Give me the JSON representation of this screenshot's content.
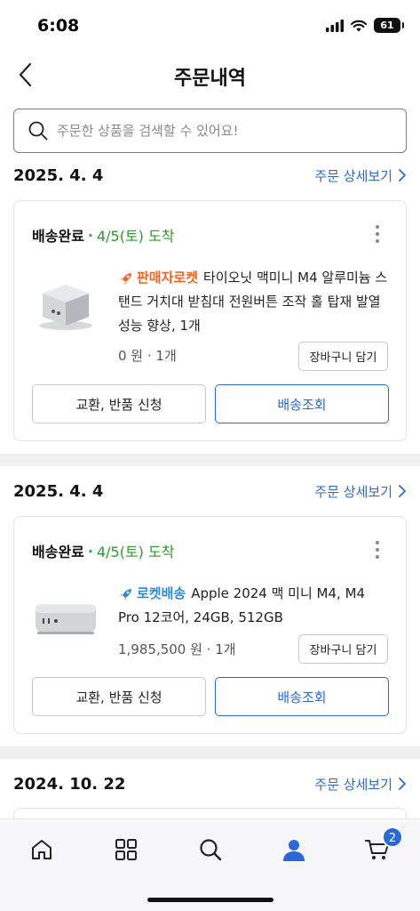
{
  "status_bar": {
    "time": "6:08",
    "battery": "61"
  },
  "header": {
    "title": "주문내역"
  },
  "search": {
    "placeholder": "주문한 상품을 검색할 수 있어요!"
  },
  "orders": [
    {
      "date": "2025. 4. 4",
      "detail_link": "주문 상세보기",
      "status": "배송완료",
      "arrival": "4/5(토) 도착",
      "badge": "판매자로켓",
      "product_name": "타이오닛 맥미니 M4 알루미늄 스탠드 거치대 받침대 전원버튼 조작 홀 탑재 발열 성능 향상, 1개",
      "price_qty": "0 원 · 1개",
      "cart_button": "장바구니 담기",
      "exchange_button": "교환, 반품 신청",
      "tracking_button": "배송조회"
    },
    {
      "date": "2025. 4. 4",
      "detail_link": "주문 상세보기",
      "status": "배송완료",
      "arrival": "4/5(토) 도착",
      "badge": "로켓배송",
      "product_name": "Apple 2024 맥 미니 M4, M4 Pro 12코어, 24GB, 512GB",
      "price_qty": "1,985,500 원 · 1개",
      "cart_button": "장바구니 담기",
      "exchange_button": "교환, 반품 신청",
      "tracking_button": "배송조회"
    },
    {
      "date": "2024. 10. 22",
      "detail_link": "주문 상세보기"
    }
  ],
  "bottom_nav": {
    "items": [
      "home-icon",
      "categories-icon",
      "search-icon",
      "my-account-icon",
      "cart-icon"
    ],
    "cart_count": "2",
    "active_color": "#2a68d8"
  }
}
